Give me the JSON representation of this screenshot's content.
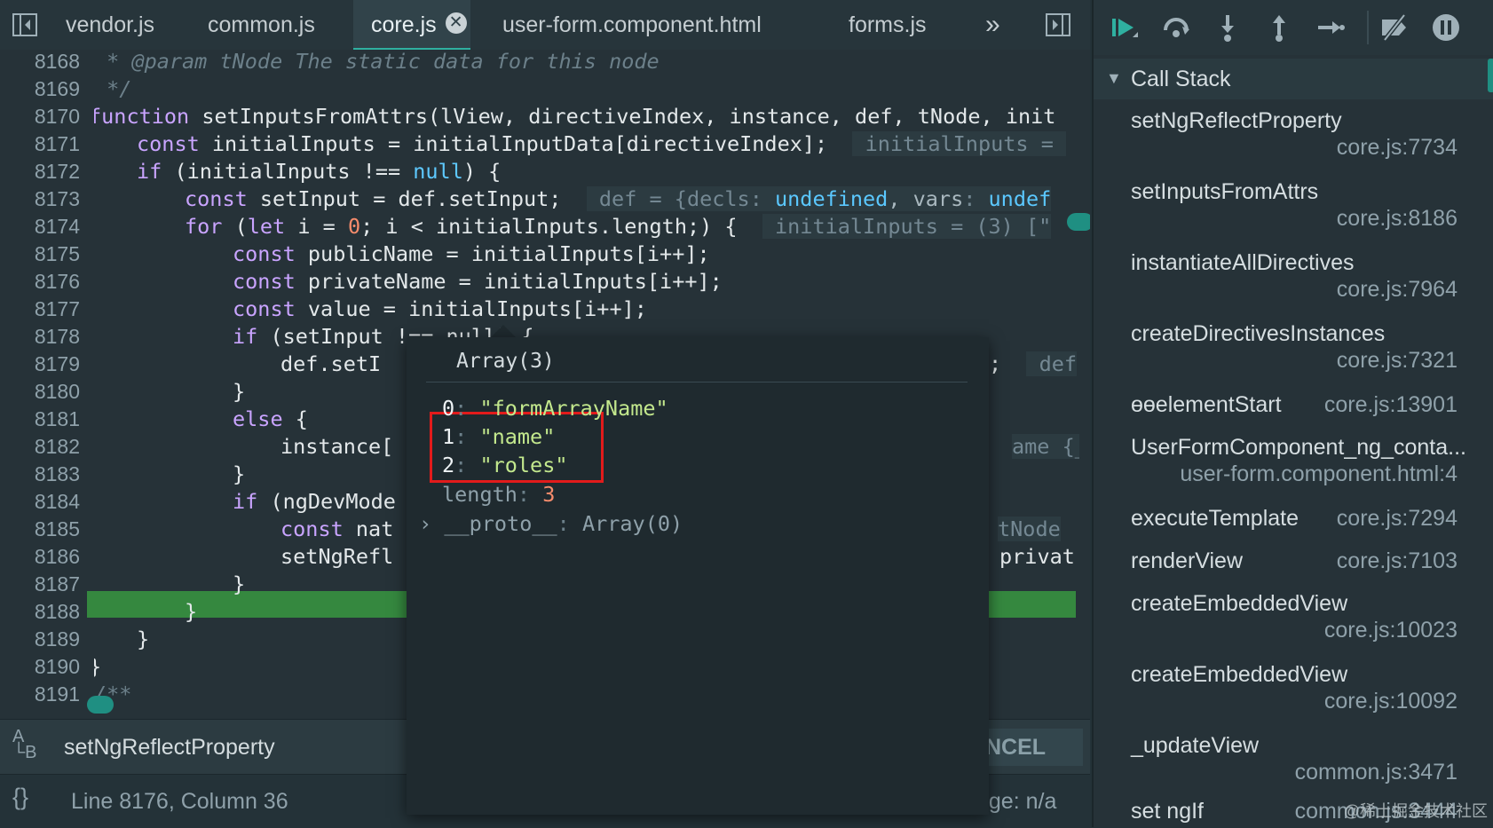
{
  "tabs": [
    {
      "label": "vendor.js",
      "active": false
    },
    {
      "label": "common.js",
      "active": false
    },
    {
      "label": "core.js",
      "active": true
    },
    {
      "label": "user-form.component.html",
      "active": false
    },
    {
      "label": "forms.js",
      "active": false
    }
  ],
  "more_tabs": "»",
  "tab_close": "✕",
  "line_numbers": [
    "8168",
    "8169",
    "8170",
    "8171",
    "8172",
    "8173",
    "8174",
    "8175",
    "8176",
    "8177",
    "8178",
    "8179",
    "8180",
    "8181",
    "8182",
    "8183",
    "8184",
    "8185",
    "8186",
    "8187",
    "8188",
    "8189",
    "8190",
    "8191"
  ],
  "code": {
    "l8168": " * @param tNode The static data for this node",
    "l8169": " */",
    "l8170_kw": "function",
    "l8170_rest": " setInputsFromAttrs(lView, directiveIndex, instance, def, tNode, init",
    "l8171_kw": "const",
    "l8171_rest": " initialInputs = initialInputData[directiveIndex];",
    "l8171_inl": " initialInputs = ",
    "l8172_kw": "if",
    "l8172_a": " (initialInputs !== ",
    "l8172_null": "null",
    "l8172_b": ") {",
    "l8173_kw": "const",
    "l8173_rest": " setInput = def.setInput;",
    "l8173_inl_a": " def = {decls",
    "l8173_inl_b": ": ",
    "l8173_inl_c": "undefined",
    "l8173_inl_d": ", vars",
    "l8173_inl_e": ": ",
    "l8173_inl_f": "undef",
    "l8174_kw": "for",
    "l8174_a": " (",
    "l8174_let": "let",
    "l8174_b": " i = ",
    "l8174_num": "0",
    "l8174_c": "; i < initialInputs.length;) {",
    "l8174_inl": " initialInputs = (3) [\"",
    "l8175_kw": "const",
    "l8175_rest": " publicName = initialInputs[i++];",
    "l8176_kw": "const",
    "l8176_rest": " privateName = initialInputs[i++];",
    "l8177_kw": "const",
    "l8177_rest": " value = initialInputs[i++];",
    "l8178_kw": "if",
    "l8178_rest": " (setInput !== null) {",
    "l8179_rest": "def.setI",
    "l8179_tail": ";",
    "l8179_inl": " def",
    "l8180": "}",
    "l8181_kw": "else",
    "l8181_rest": " {",
    "l8182_rest": "instance[",
    "l8182_inl": "ame {_pa",
    "l8183": "}",
    "l8184_kw": "if",
    "l8184_rest": " (ngDevMode",
    "l8185_kw": "const",
    "l8185_rest": " nat",
    "l8185_inl": "tNode",
    "l8186_rest": "setNgRefl",
    "l8186_tail": "privat",
    "l8187": "}",
    "l8188": "}",
    "l8189": "}",
    "l8190": "}",
    "l8191": "/**"
  },
  "popover": {
    "title": "Array(3)",
    "items": [
      {
        "key": "0",
        "value": "\"formArrayName\""
      },
      {
        "key": "1",
        "value": "\"name\""
      },
      {
        "key": "2",
        "value": "\"roles\""
      }
    ],
    "length_label": "length",
    "length_value": "3",
    "proto_label": "__proto__",
    "proto_value": "Array(0)",
    "expand_glyph": "›"
  },
  "search": {
    "icon_text_a": "A",
    "icon_text_b": "└B",
    "query": "setNgReflectProperty",
    "cancel_label": "NCEL"
  },
  "status": {
    "pretty_print": "{}",
    "position": "Line 8176, Column 36",
    "coverage": "age: n/a"
  },
  "call_stack": {
    "title": "Call Stack",
    "frames": [
      {
        "name": "setNgReflectProperty",
        "loc": "core.js:7734",
        "inline": false
      },
      {
        "name": "setInputsFromAttrs",
        "loc": "core.js:8186",
        "inline": false
      },
      {
        "name": "instantiateAllDirectives",
        "loc": "core.js:7964",
        "inline": false
      },
      {
        "name": "createDirectivesInstances",
        "loc": "core.js:7321",
        "inline": false
      },
      {
        "name": "ɵɵelementStart",
        "loc": "core.js:13901",
        "inline": true
      },
      {
        "name": "UserFormComponent_ng_conta...",
        "loc": "user-form.component.html:4",
        "inline": false
      },
      {
        "name": "executeTemplate",
        "loc": "core.js:7294",
        "inline": true
      },
      {
        "name": "renderView",
        "loc": "core.js:7103",
        "inline": true
      },
      {
        "name": "createEmbeddedView",
        "loc": "core.js:10023",
        "inline": false
      },
      {
        "name": "createEmbeddedView",
        "loc": "core.js:10092",
        "inline": false
      },
      {
        "name": "_updateView",
        "loc": "common.js:3471",
        "inline": false
      },
      {
        "name": "set ngIf",
        "loc": "common.js:3444",
        "inline": true
      }
    ]
  },
  "watermark": "@稀土掘金技术社区",
  "colors": {
    "accent": "#2fb0a0",
    "exec_line": "#35883f",
    "highlight_box": "#e21b1b"
  }
}
